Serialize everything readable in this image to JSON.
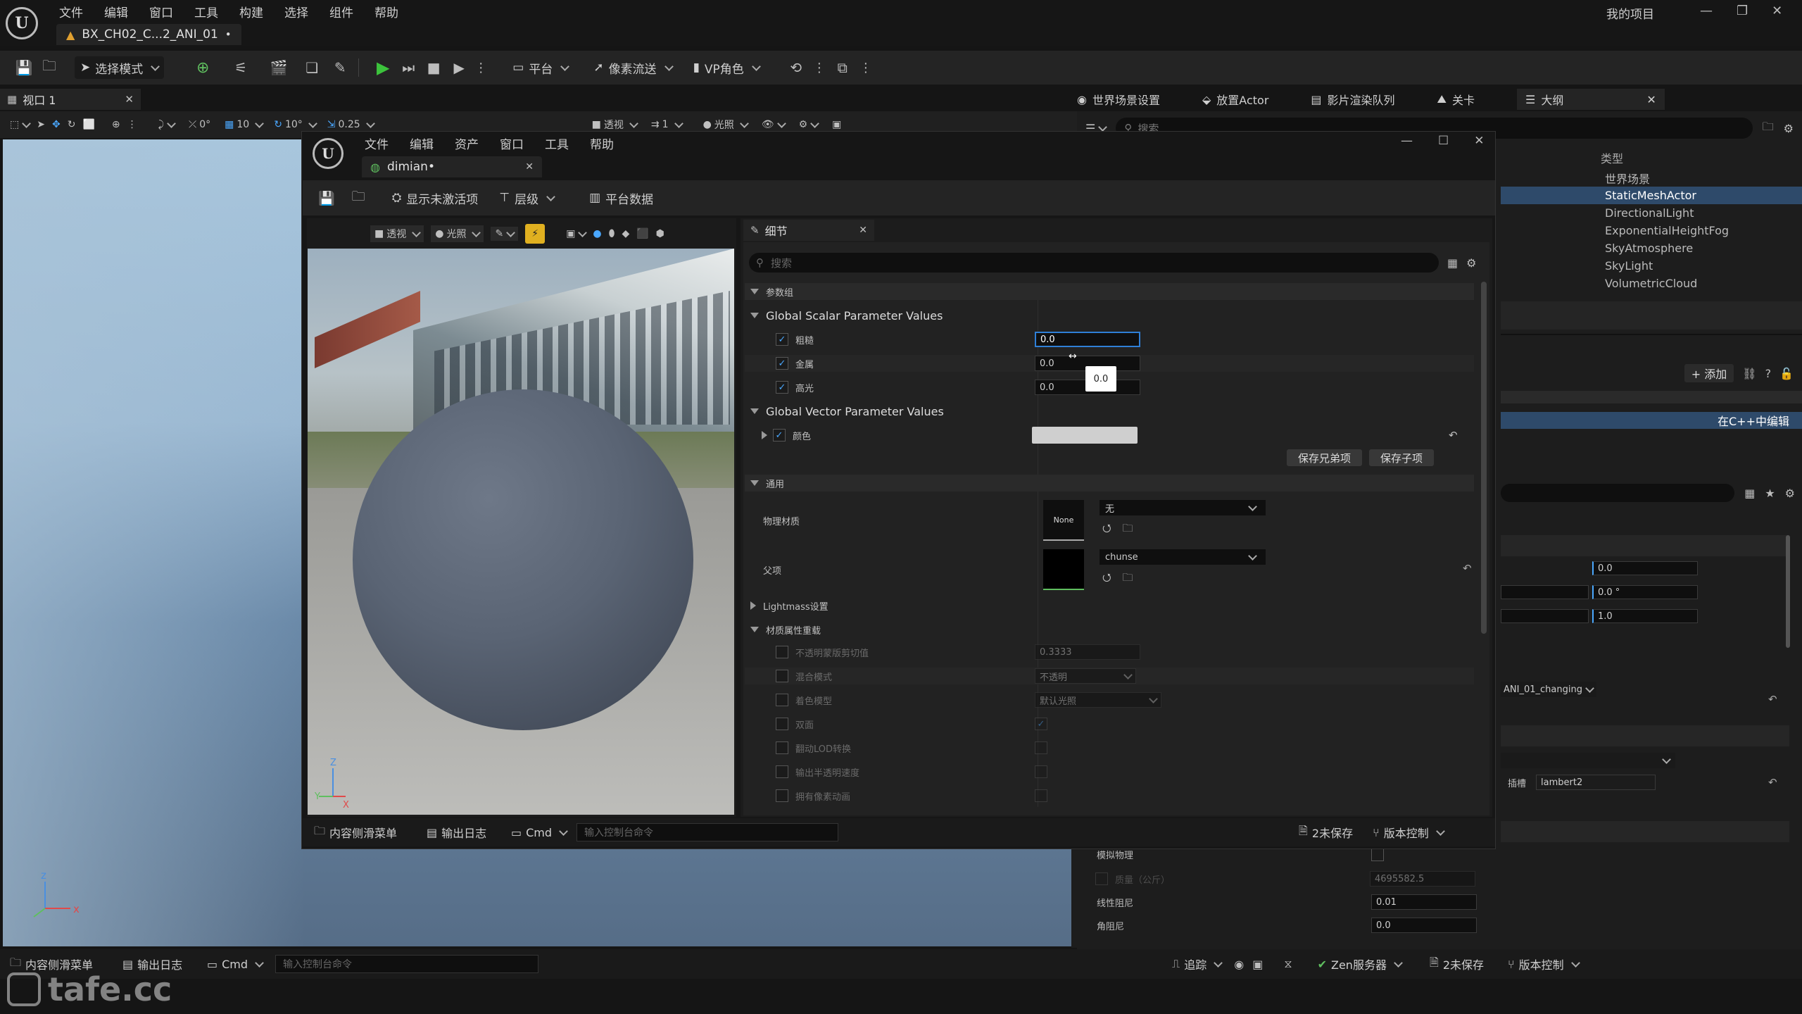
{
  "main": {
    "menu": [
      "文件",
      "编辑",
      "窗口",
      "工具",
      "构建",
      "选择",
      "组件",
      "帮助"
    ],
    "tab_title": "BX_CH02_C...2_ANI_01",
    "project_name": "我的项目",
    "toolbar": {
      "mode": "选择模式",
      "platform": "平台",
      "pixel_stream": "像素流送",
      "vp_role": "VP角色"
    },
    "right_tabs": [
      "世界场景设置",
      "放置Actor",
      "影片渲染队列",
      "关卡",
      "大纲"
    ],
    "viewport_tab": "视口 1",
    "viewport_toolbar": {
      "rot_val": "0°",
      "grid_val": "10",
      "angle_val": "10°",
      "scale_val": "0.25",
      "view": "透视",
      "light": "光照",
      "cam_speed": "1"
    },
    "outliner": {
      "search_placeholder": "搜索",
      "type_header": "类型",
      "types": [
        "世界场景",
        "StaticMeshActor",
        "DirectionalLight",
        "ExponentialHeightFog",
        "SkyAtmosphere",
        "SkyLight",
        "VolumetricCloud"
      ]
    },
    "details": {
      "add_label": "+ 添加",
      "cpp_edit": "在C++中编辑",
      "values": [
        "0.0",
        "0.0 °",
        "1.0"
      ],
      "anim_select": "ANI_01_changing",
      "slot_label": "插槽",
      "slot_value": "lambert2",
      "physics_label": "模拟物理",
      "mass_label": "质量（公斤）",
      "mass_value": "4695582.5",
      "linear_label": "线性阻尼",
      "linear_value": "0.01",
      "angular_label": "角阻尼",
      "angular_value": "0.0"
    },
    "statusbar": {
      "content_drawer": "内容侧滑菜单",
      "output_log": "输出日志",
      "cmd": "Cmd",
      "cmd_placeholder": "输入控制台命令",
      "trace": "追踪",
      "zen": "Zen服务器",
      "unsaved": "2未保存",
      "vcs": "版本控制"
    },
    "watermark": "tafe.cc"
  },
  "editor": {
    "menu": [
      "文件",
      "编辑",
      "资产",
      "窗口",
      "工具",
      "帮助"
    ],
    "tab": "dimian•",
    "toolbar": {
      "show_inactive": "显示未激活项",
      "hierarchy": "层级",
      "platform_data": "平台数据"
    },
    "preview": {
      "view": "透视",
      "light": "光照"
    },
    "details": {
      "tab": "细节",
      "search_placeholder": "搜索",
      "group_params": "参数组",
      "scalar_header": "Global Scalar Parameter Values",
      "scalars": [
        {
          "name": "粗糙",
          "value": "0.0"
        },
        {
          "name": "金属",
          "value": "0.0"
        },
        {
          "name": "高光",
          "value": "0.0"
        }
      ],
      "tooltip_value": "0.0",
      "vector_header": "Global Vector Parameter Values",
      "vector_name": "颜色",
      "save_sibling": "保存兄弟项",
      "save_child": "保存子项",
      "general_header": "通用",
      "phys_mat_label": "物理材质",
      "phys_mat_thumb": "None",
      "phys_mat_value": "无",
      "parent_label": "父项",
      "parent_value": "chunse",
      "lightmass": "Lightmass设置",
      "overrides_header": "材质属性重载",
      "overrides": [
        {
          "name": "不透明蒙版剪切值",
          "value": "0.3333"
        },
        {
          "name": "混合模式",
          "value": "不透明"
        },
        {
          "name": "着色模型",
          "value": "默认光照"
        },
        {
          "name": "双面",
          "value": ""
        },
        {
          "name": "翻动LOD转换",
          "value": ""
        },
        {
          "name": "输出半透明速度",
          "value": ""
        },
        {
          "name": "拥有像素动画",
          "value": ""
        }
      ]
    },
    "statusbar": {
      "content_drawer": "内容侧滑菜单",
      "output_log": "输出日志",
      "cmd": "Cmd",
      "cmd_placeholder": "输入控制台命令",
      "unsaved": "2未保存",
      "vcs": "版本控制"
    }
  }
}
